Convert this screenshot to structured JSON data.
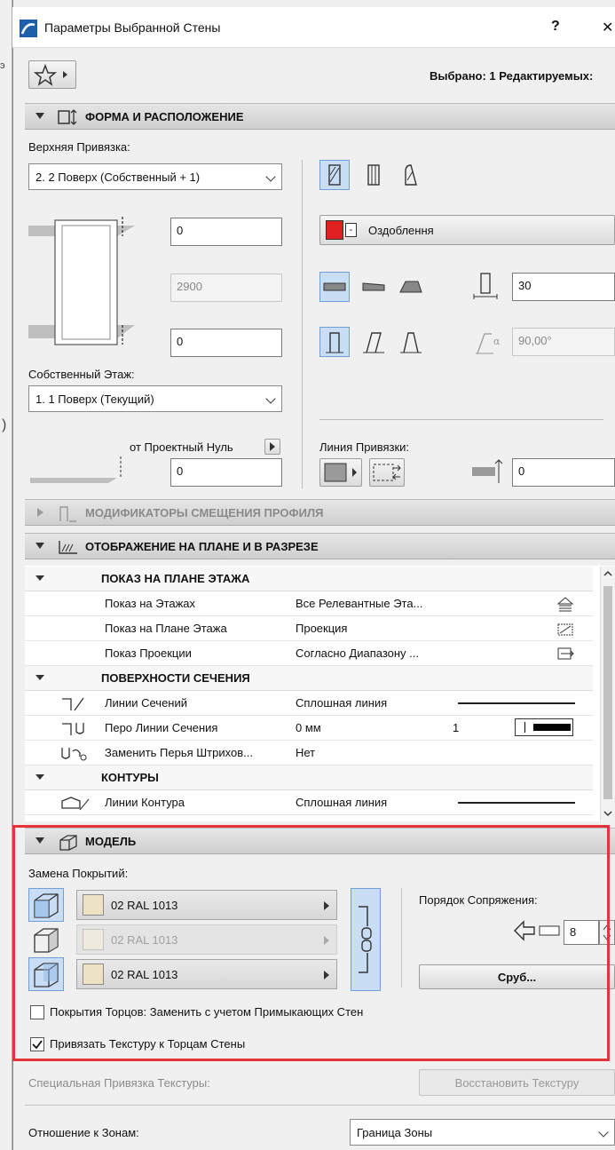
{
  "window": {
    "title": "Параметры Выбранной Стены",
    "help_label": "?",
    "close_label": "✕",
    "selection_info": "Выбрано: 1 Редактируемых:"
  },
  "left_strip": {
    "glyph1": "э",
    "glyph2": ")"
  },
  "shape_section": {
    "title": "ФОРМА И РАСПОЛОЖЕНИЕ",
    "top_link_label": "Верхняя Привязка:",
    "top_link_value": "2. 2 Поверх (Собственный + 1)",
    "top_offset": "0",
    "height": "2900",
    "bottom_offset": "0",
    "home_story_label": "Собственный Этаж:",
    "home_story_value": "1. 1 Поверх (Текущий)",
    "project_zero_label": "от Проектный Нуль",
    "project_zero_value": "0",
    "finish_label": "Оздоблення",
    "thickness": "30",
    "angle": "90,00°",
    "ref_line_label": "Линия Привязки:",
    "ref_line_offset": "0"
  },
  "profile_section": {
    "title": "МОДИФИКАТОРЫ СМЕЩЕНИЯ ПРОФИЛЯ"
  },
  "plan_section": {
    "title": "ОТОБРАЖЕНИЕ НА ПЛАНЕ И В РАЗРЕЗЕ",
    "groups": [
      {
        "title": "ПОКАЗ НА ПЛАНЕ ЭТАЖА"
      },
      {
        "title": "ПОВЕРХНОСТИ СЕЧЕНИЯ"
      },
      {
        "title": "КОНТУРЫ"
      }
    ],
    "rows": [
      {
        "label": "Показ на Этажах",
        "value": "Все Релевантные Эта..."
      },
      {
        "label": "Показ на Плане Этажа",
        "value": "Проекция"
      },
      {
        "label": "Показ Проекции",
        "value": "Согласно Диапазону ..."
      },
      {
        "label": "Линии Сечений",
        "value": "Сплошная линия"
      },
      {
        "label": "Перо Линии Сечения",
        "value": "0 мм",
        "extra": "1"
      },
      {
        "label": "Заменить Перья Штрихов...",
        "value": "Нет"
      },
      {
        "label": "Линии Контура",
        "value": "Сплошная линия"
      }
    ]
  },
  "model_section": {
    "title": "МОДЕЛЬ",
    "override_label": "Замена Покрытий:",
    "surfaces": [
      {
        "name": "02 RAL 1013",
        "enabled": true
      },
      {
        "name": "02 RAL 1013",
        "enabled": false
      },
      {
        "name": "02 RAL 1013",
        "enabled": true
      }
    ],
    "junction_label": "Порядок Сопряжения:",
    "junction_value": "8",
    "log_button": "Сруб...",
    "edge_checkbox_label": "Покрытия Торцов: Заменить с учетом Примыкающих Стен",
    "edge_checked": false,
    "texture_checkbox_label": "Привязать Текстуру к Торцам Стены",
    "texture_checked": true
  },
  "footer": {
    "texture_align_label": "Специальная Привязка Текстуры:",
    "restore_button": "Восстановить Текстуру",
    "zones_label": "Отношение к Зонам:",
    "zones_value": "Граница Зоны"
  },
  "colors": {
    "highlight": "#e8333a",
    "active_blue": "#c9def5",
    "finish_red": "#e02020"
  }
}
